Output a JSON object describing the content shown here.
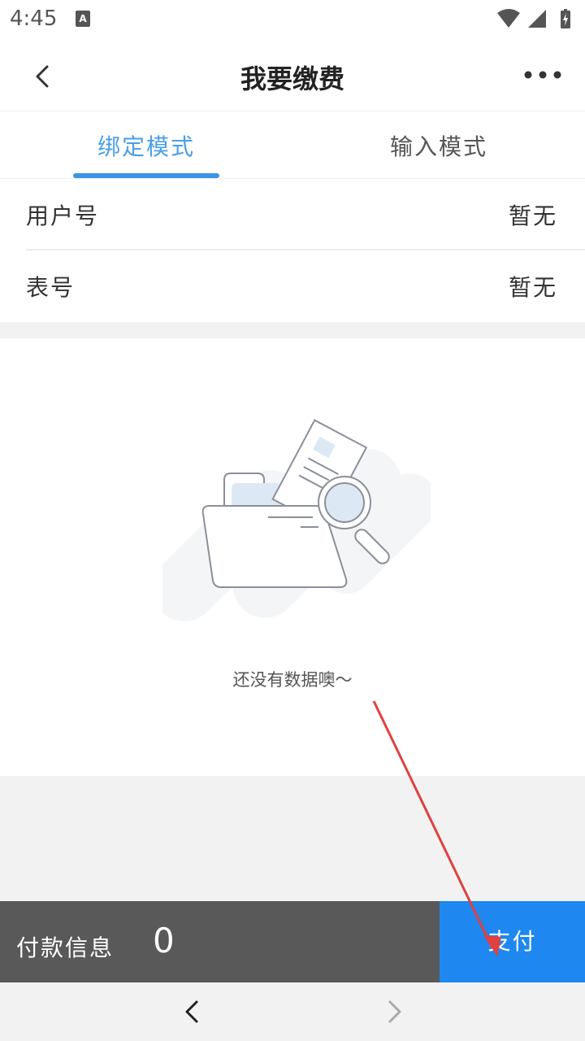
{
  "status_bar": {
    "time": "4:45"
  },
  "header": {
    "title": "我要缴费",
    "back_icon": "chevron-left-icon",
    "more_icon": "more-dots-icon"
  },
  "tabs": [
    {
      "label": "绑定模式",
      "active": true
    },
    {
      "label": "输入模式",
      "active": false
    }
  ],
  "info_rows": [
    {
      "label": "用户号",
      "value": "暂无"
    },
    {
      "label": "表号",
      "value": "暂无"
    }
  ],
  "empty_state": {
    "message": "还没有数据噢～",
    "icon": "empty-folder-search-icon"
  },
  "payment": {
    "label": "付款信息",
    "amount": "0",
    "pay_button": "支付"
  },
  "colors": {
    "accent": "#3d94e6",
    "pay_button": "#1f87f0",
    "pay_bar": "#595959",
    "annotation_arrow": "#e04040"
  }
}
